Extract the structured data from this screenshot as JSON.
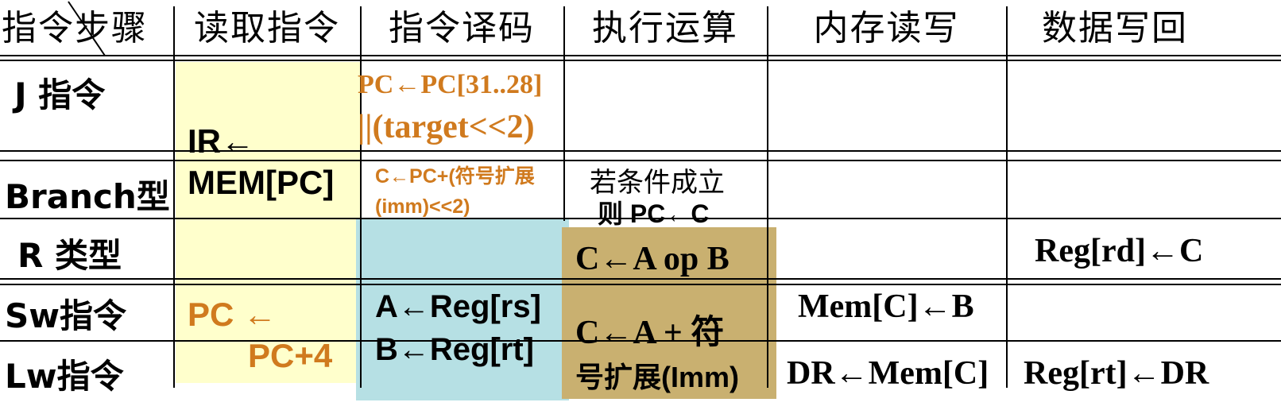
{
  "colors": {
    "fetch_fill": "#ffffcc",
    "decode_fill": "#b6e0e4",
    "execute_fill": "#c9b070",
    "orange_text": "#d07a1e",
    "grid": "#000000"
  },
  "header": {
    "corner": "指令步骤",
    "col_fetch": "读取指令",
    "col_decode": "指令译码",
    "col_execute": "执行运算",
    "col_memory": "内存读写",
    "col_writeback": "数据写回"
  },
  "rows": {
    "j": "J 指令",
    "branch": "Branch型",
    "r": "R 类型",
    "sw": "Sw指令",
    "lw": "Lw指令"
  },
  "cells": {
    "fetch_ir_1": "IR←",
    "fetch_ir_2": "MEM[PC]",
    "fetch_pc_1": "PC ←",
    "fetch_pc_2": "PC+4",
    "j_decode_1": "PC←PC[31..28]",
    "j_decode_2": "||(target<<2)",
    "branch_decode_1": "C←PC+(符号扩展",
    "branch_decode_2": "(imm)<<2)",
    "branch_exec_1": "若条件成立",
    "branch_exec_2": "则  PC←C",
    "decode_a": "A←Reg[rs]",
    "decode_b": "B←Reg[rt]",
    "exec_r": "C←A op B",
    "exec_mem_1": "C←A + 符",
    "exec_mem_2": "号扩展(Imm)",
    "r_writeback": "Reg[rd]←C",
    "sw_memory": "Mem[C]←B",
    "lw_memory": "DR←Mem[C]",
    "lw_writeback": "Reg[rt]←DR"
  }
}
